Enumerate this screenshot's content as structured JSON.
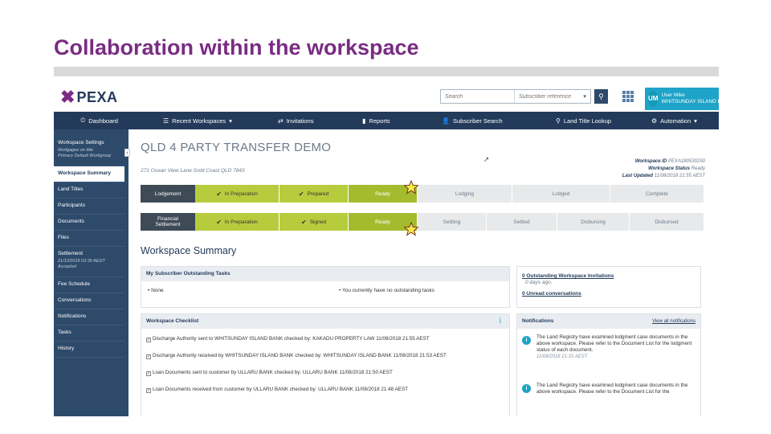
{
  "slide": {
    "title": "Collaboration within the workspace"
  },
  "header": {
    "logo_mark": "✖",
    "logo_text": "PEXA",
    "search_placeholder": "Search",
    "reference_placeholder": "Subscriber reference",
    "search_icon": "magnifier-icon",
    "user_initials": "UM",
    "user_name": "User Mike",
    "user_org": "WHITSUNDAY ISLAND B"
  },
  "nav": {
    "items": [
      {
        "label": "Dashboard",
        "icon": "⏲"
      },
      {
        "label": "Recent Workspaces",
        "icon": "☰",
        "caret": "▾"
      },
      {
        "label": "Invitations",
        "icon": "⇄"
      },
      {
        "label": "Reports",
        "icon": "▮"
      },
      {
        "label": "Subscriber Search",
        "icon": "👤"
      },
      {
        "label": "Land Title Lookup",
        "icon": "⚲"
      },
      {
        "label": "Automation",
        "icon": "⚙",
        "caret": "▾"
      }
    ]
  },
  "sidebar": {
    "collapse": "‹",
    "items": [
      {
        "label": "Workspace Settings",
        "sub": "Mortgagee on title\nPrimary Default Workgroup"
      },
      {
        "label": "Workspace Summary",
        "active": true
      },
      {
        "label": "Land Titles"
      },
      {
        "label": "Participants"
      },
      {
        "label": "Documents"
      },
      {
        "label": "Files"
      },
      {
        "label": "Settlement",
        "sub": "21/12/2018 03:30 AEDT\nAccepted"
      },
      {
        "label": "Fee Schedule"
      },
      {
        "label": "Conversations"
      },
      {
        "label": "Notifications"
      },
      {
        "label": "Tasks"
      },
      {
        "label": "History"
      }
    ]
  },
  "workspace": {
    "title": "QLD 4 PARTY TRANSFER DEMO",
    "address": "271 Ocean View Lane Gold Coast QLD 7843",
    "meta": [
      {
        "k": "Workspace ID",
        "v": "PEXA180530250"
      },
      {
        "k": "Workspace Status",
        "v": "Ready"
      },
      {
        "k": "Last Updated",
        "v": "11/08/2018 21:55 AEST"
      }
    ]
  },
  "lodgement_track": {
    "label": "Lodgement",
    "stages": [
      {
        "label": "In Preparation",
        "state": "done"
      },
      {
        "label": "Prepared",
        "state": "done"
      },
      {
        "label": "Ready",
        "state": "ready"
      },
      {
        "label": "Lodging",
        "state": "todo"
      },
      {
        "label": "Lodged",
        "state": "todo"
      },
      {
        "label": "Complete",
        "state": "todo"
      }
    ]
  },
  "settlement_track": {
    "label": "Financial\nSettlement",
    "stages": [
      {
        "label": "In Preparation",
        "state": "done"
      },
      {
        "label": "Signed",
        "state": "done"
      },
      {
        "label": "Ready",
        "state": "ready"
      },
      {
        "label": "Settling",
        "state": "todo"
      },
      {
        "label": "Settled",
        "state": "todo"
      },
      {
        "label": "Disbursing",
        "state": "todo"
      },
      {
        "label": "Disbursed",
        "state": "todo"
      }
    ]
  },
  "summary": {
    "heading": "Workspace Summary",
    "tasks_panel": {
      "title": "My Subscriber Outstanding Tasks",
      "left": "None",
      "right": "You currently have no outstanding tasks"
    },
    "invites_panel": {
      "invitations_link": "0 Outstanding Workspace Invitations",
      "invitations_age": "0 days ago.",
      "conversations_link": "0 Unread conversations"
    },
    "checklist_panel": {
      "title": "Workspace Checklist",
      "info_icon": "i",
      "rows": [
        "Discharge Authority sent to WHITSUNDAY ISLAND BANK checked by: KAKADU PROPERTY LAW 11/08/2018 21:55 AEST",
        "Discharge Authority received by WHITSUNDAY ISLAND BANK checked by: WHITSUNDAY ISLAND BANK 11/08/2018 21:53 AEST",
        "Loan Documents sent to customer by ULLARU BANK checked by: ULLARU BANK 11/08/2018 21:50 AEST",
        "Loan Documents received from customer by ULLARU BANK checked by: ULLARU BANK 11/08/2018 21:48 AEST"
      ]
    },
    "notifications_panel": {
      "title": "Notifications",
      "view_all": "View all notifications",
      "items": [
        {
          "text": "The Land Registry have examined lodgment case documents in the above workspace. Please refer to the Document List for the lodgment status of each document.",
          "date": "11/08/2018 21:15 AEST"
        },
        {
          "text": "The Land Registry have examined lodgment case documents in the above workspace. Please refer to the Document List for the",
          "date": ""
        }
      ]
    }
  },
  "colors": {
    "brand": "#7a2c82",
    "navy": "#233a5a",
    "sidebar": "#2d4a6b",
    "green": "#b7cc3d",
    "cyan": "#1fa3c8"
  }
}
